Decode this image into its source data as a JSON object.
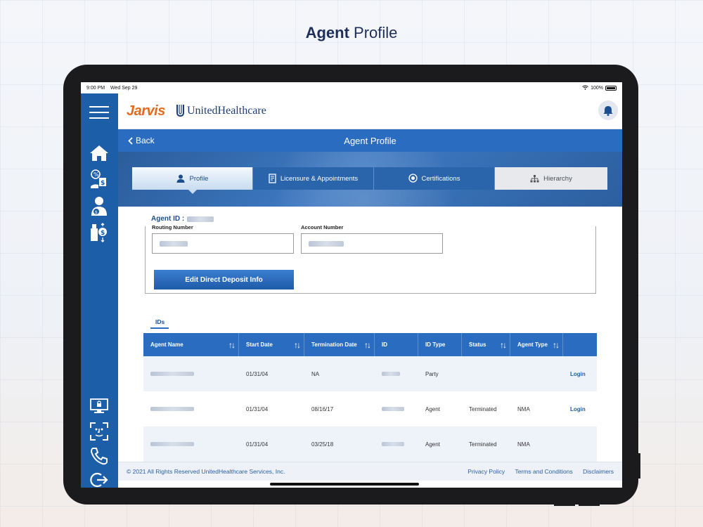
{
  "page_title": {
    "bold": "Agent",
    "rest": " Profile"
  },
  "status_bar": {
    "time": "9:00 PM",
    "date": "Wed Sep 29",
    "battery": "100%"
  },
  "header": {
    "logo_jarvis": "Jarvis",
    "logo_uhc": "UnitedHealthcare"
  },
  "nav": {
    "back_label": "Back",
    "title": "Agent Profile"
  },
  "tabs": [
    {
      "label": "Profile",
      "icon": "user-icon"
    },
    {
      "label": "Licensure & Appointments",
      "icon": "document-icon"
    },
    {
      "label": "Certifications",
      "icon": "badge-icon"
    },
    {
      "label": "Hierarchy",
      "icon": "hierarchy-icon"
    }
  ],
  "profile": {
    "agent_id_label": "Agent ID :",
    "routing_label": "Routing Number",
    "account_label": "Account Number",
    "edit_button": "Edit Direct Deposit Info"
  },
  "ids_section": {
    "tab_label": "IDs",
    "columns": [
      "Agent Name",
      "Start Date",
      "Termination Date",
      "ID",
      "ID Type",
      "Status",
      "Agent Type",
      ""
    ],
    "rows": [
      {
        "start": "01/31/04",
        "term": "NA",
        "id_type": "Party",
        "status": "",
        "agent_type": "",
        "action": "Login"
      },
      {
        "start": "01/31/04",
        "term": "08/16/17",
        "id_type": "Agent",
        "status": "Terminated",
        "agent_type": "NMA",
        "action": "Login"
      },
      {
        "start": "01/31/04",
        "term": "03/25/18",
        "id_type": "Agent",
        "status": "Terminated",
        "agent_type": "NMA",
        "action": ""
      }
    ]
  },
  "footer": {
    "copyright": "© 2021 All Rights Reserved UnitedHealthcare Services, Inc.",
    "links": [
      "Privacy Policy",
      "Terms and Conditions",
      "Disclaimers"
    ]
  },
  "colors": {
    "primary": "#2a6cbf",
    "sidebar": "#1c5ea8",
    "accent": "#e36b1f"
  }
}
